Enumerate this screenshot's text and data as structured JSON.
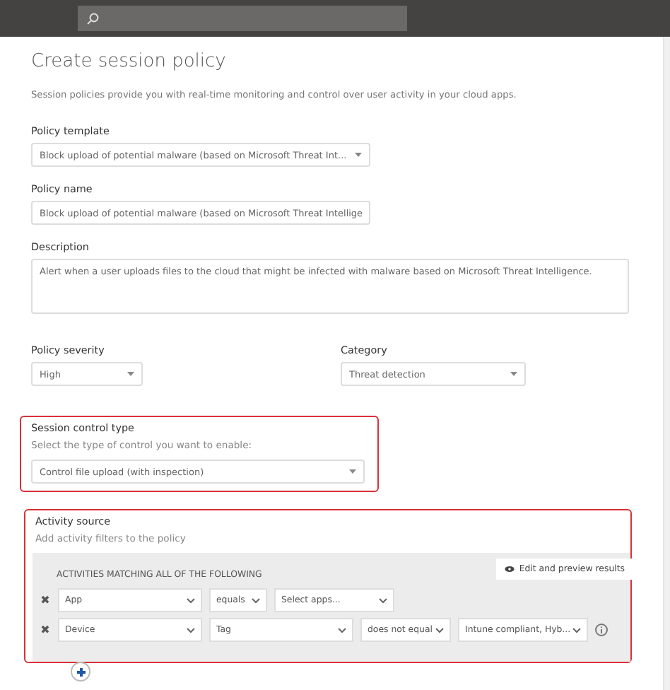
{
  "page": {
    "title": "Create session policy",
    "subtitle": "Session policies provide you with real-time monitoring and control over user activity in your cloud apps."
  },
  "policy_template": {
    "label": "Policy template",
    "value": "Block upload of potential malware (based on Microsoft Threat Int..."
  },
  "policy_name": {
    "label": "Policy name",
    "value": "Block upload of potential malware (based on Microsoft Threat Intellige"
  },
  "description": {
    "label": "Description",
    "value": "Alert when a user uploads files to the cloud that might be infected with malware based on Microsoft Threat Intelligence."
  },
  "policy_severity": {
    "label": "Policy severity",
    "value": "High"
  },
  "category": {
    "label": "Category",
    "value": "Threat detection"
  },
  "session_control": {
    "label": "Session control type",
    "hint": "Select the type of control you want to enable:",
    "value": "Control file upload (with inspection)"
  },
  "activity_source": {
    "label": "Activity source",
    "hint": "Add activity filters to the policy",
    "heading": "ACTIVITIES MATCHING ALL OF THE FOLLOWING",
    "preview_button": "Edit and preview results",
    "filters": [
      {
        "remove": "✖",
        "info": false,
        "fields": [
          "App",
          "equals",
          "Select apps..."
        ]
      },
      {
        "remove": "✖",
        "info": true,
        "fields": [
          "Device",
          "Tag",
          "does not equal",
          "Intune compliant, Hyb..."
        ]
      }
    ]
  }
}
